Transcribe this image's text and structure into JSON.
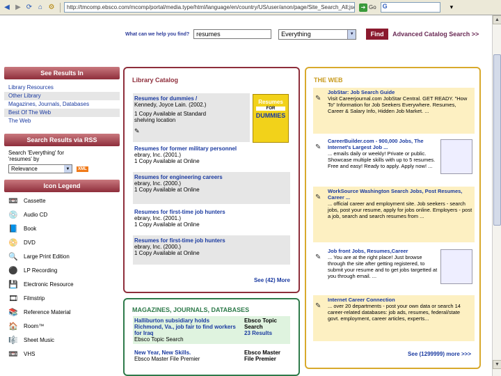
{
  "browser": {
    "url": "http://tmcomp.ebsco.com/mcomp/portal/media.type/html/language/en/country/US/user/anon/page/Site_Search_All;jsessio",
    "go_label": "Go",
    "search_value": "G"
  },
  "search": {
    "label": "What can we help you find?",
    "query": "resumes",
    "scope": "Everything",
    "find_label": "Find",
    "advanced_label": "Advanced Catalog Search >>"
  },
  "see_results": {
    "heading": "See Results In",
    "items": [
      "Library Resources",
      "Other Library",
      "Magazines, Journals, Databases",
      "Best Of The Web",
      "The Web"
    ]
  },
  "rss": {
    "heading": "Search Results via RSS",
    "line1": "Search 'Everything' for",
    "line2": "'resumes' by",
    "sort_value": "Relevance",
    "xml_label": "XML"
  },
  "icon_legend": {
    "heading": "Icon Legend",
    "items": [
      {
        "label": "Cassette",
        "icon": "cassette-icon"
      },
      {
        "label": "Audio CD",
        "icon": "audio-cd-icon"
      },
      {
        "label": "Book",
        "icon": "book-icon"
      },
      {
        "label": "DVD",
        "icon": "dvd-icon"
      },
      {
        "label": "Large Print Edition",
        "icon": "large-print-icon"
      },
      {
        "label": "LP Recording",
        "icon": "lp-recording-icon"
      },
      {
        "label": "Electronic Resource",
        "icon": "electronic-resource-icon"
      },
      {
        "label": "Filmstrip",
        "icon": "filmstrip-icon"
      },
      {
        "label": "Reference Material",
        "icon": "reference-material-icon"
      },
      {
        "label": "Room™",
        "icon": "room-icon"
      },
      {
        "label": "Sheet Music",
        "icon": "sheet-music-icon"
      },
      {
        "label": "VHS",
        "icon": "vhs-icon"
      }
    ]
  },
  "catalog": {
    "title": "Library Catalog",
    "cover": {
      "line1": "Resumes",
      "line2": "FOR",
      "line3": "DUMMIES"
    },
    "items": [
      {
        "title": "Resumes for dummies /",
        "author": "Kennedy, Joyce Lain. (2002.)",
        "avail": "1 Copy Available at Standard shelving location"
      },
      {
        "title": "Resumes for former military personnel",
        "author": "ebrary, Inc. (2001.)",
        "avail": "1 Copy Available at Online"
      },
      {
        "title": "Resumes for engineering careers",
        "author": "ebrary, Inc. (2000.)",
        "avail": "1 Copy Available at Online"
      },
      {
        "title": "Resumes for first-time job hunters",
        "author": "ebrary, Inc. (2001.)",
        "avail": "1 Copy Available at Online"
      },
      {
        "title": "Resumes for first-time job hunters",
        "author": "ebrary, Inc. (2000.)",
        "avail": "1 Copy Available at Online"
      }
    ],
    "see_more": "See (42) More"
  },
  "web": {
    "title": "THE WEB",
    "items": [
      {
        "title": "JobStar: Job Search Guide",
        "desc": "Visit Careerjournal.com JobStar Central. GET READY. \"How To\" Information for Job Seekers Everywhere. Resumes, Career & Salary Info, Hidden Job Market. ..."
      },
      {
        "title": "CareerBuilder.com - 900,000 Jobs, The Internet's Largest Job ...",
        "desc": "... emails daily or weekly! Private or public. Showcase multiple skills with up to 5 resumes. Free and easy! Ready to apply. Apply now! ..."
      },
      {
        "title": "WorkSource Washington Search Jobs, Post Resumes, Career ...",
        "desc": "... official career and employment site. Job seekers - search jobs, post your resume, apply for jobs online. Employers - post a job, search and search resumes from ..."
      },
      {
        "title": "Job front Jobs, Resumes,Career",
        "desc": "... You are at the right place! Just browse through the site after getting registered, to submit your resume and to get jobs targetted at you through email. ..."
      },
      {
        "title": "Internet Career Connection",
        "desc": "... over 20 departments - post your own data or search 14 career-related databases: job ads, resumes, federal/state govt. employment, career articles, experts..."
      }
    ],
    "see_more": "See (1299999) more >>>"
  },
  "magazines": {
    "title": "MAGAZINES, JOURNALS, DATABASES",
    "items": [
      {
        "title": "Halliburton subsidiary holds Richmond, Va., job fair to find workers for Iraq",
        "source": "Ebsco Topic Search",
        "src_line1": "Ebsco Topic",
        "src_line2": "Search",
        "count": "23 Results"
      },
      {
        "title": "New Year, New Skills.",
        "source": "Ebsco Master File Premier",
        "src_line1": "Ebsco Master",
        "src_line2": "File Premier",
        "count": ""
      }
    ]
  }
}
